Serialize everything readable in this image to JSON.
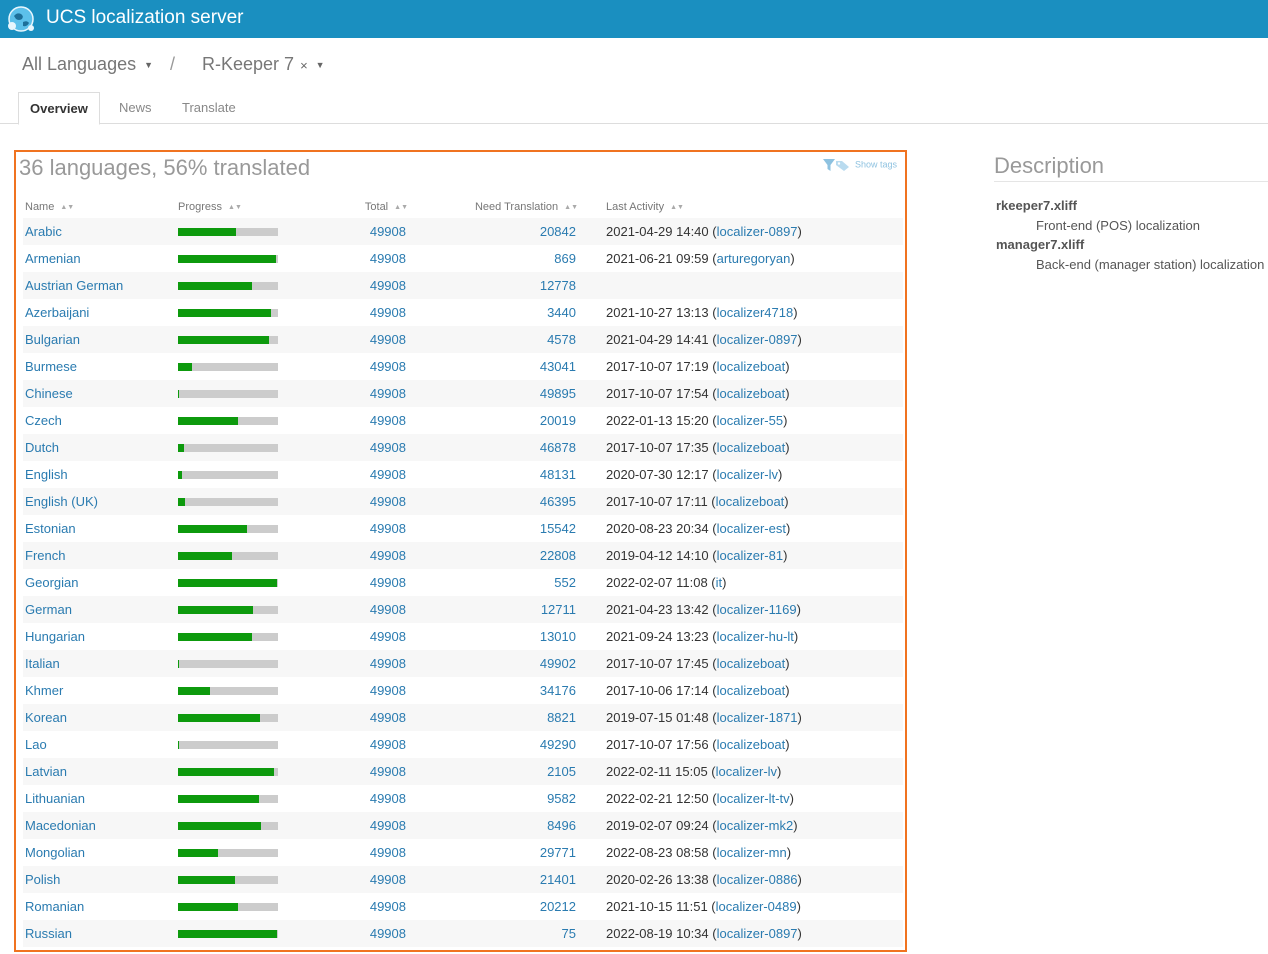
{
  "app": {
    "title": "UCS localization server"
  },
  "breadcrumb": {
    "languages": "All Languages",
    "separator": "/",
    "project": "R-Keeper 7",
    "remove": "×"
  },
  "tabs": [
    {
      "label": "Overview",
      "active": true
    },
    {
      "label": "News",
      "active": false
    },
    {
      "label": "Translate",
      "active": false
    }
  ],
  "summary": "36 languages, 56% translated",
  "show_tags": "Show tags",
  "columns": {
    "name": "Name",
    "progress": "Progress",
    "total": "Total",
    "need": "Need Translation",
    "activity": "Last Activity"
  },
  "rows": [
    {
      "name": "Arabic",
      "total": "49908",
      "need": "20842",
      "date": "2021-04-29 14:40",
      "user": "localizer-0897",
      "progress": 0.58
    },
    {
      "name": "Armenian",
      "total": "49908",
      "need": "869",
      "date": "2021-06-21 09:59",
      "user": "arturegoryan",
      "progress": 0.98
    },
    {
      "name": "Austrian German",
      "total": "49908",
      "need": "12778",
      "date": "",
      "user": "",
      "progress": 0.74
    },
    {
      "name": "Azerbaijani",
      "total": "49908",
      "need": "3440",
      "date": "2021-10-27 13:13",
      "user": "localizer4718",
      "progress": 0.93
    },
    {
      "name": "Bulgarian",
      "total": "49908",
      "need": "4578",
      "date": "2021-04-29 14:41",
      "user": "localizer-0897",
      "progress": 0.91
    },
    {
      "name": "Burmese",
      "total": "49908",
      "need": "43041",
      "date": "2017-10-07 17:19",
      "user": "localizeboat",
      "progress": 0.14
    },
    {
      "name": "Chinese",
      "total": "49908",
      "need": "49895",
      "date": "2017-10-07 17:54",
      "user": "localizeboat",
      "progress": 0.01
    },
    {
      "name": "Czech",
      "total": "49908",
      "need": "20019",
      "date": "2022-01-13 15:20",
      "user": "localizer-55",
      "progress": 0.6
    },
    {
      "name": "Dutch",
      "total": "49908",
      "need": "46878",
      "date": "2017-10-07 17:35",
      "user": "localizeboat",
      "progress": 0.06
    },
    {
      "name": "English",
      "total": "49908",
      "need": "48131",
      "date": "2020-07-30 12:17",
      "user": "localizer-lv",
      "progress": 0.04
    },
    {
      "name": "English (UK)",
      "total": "49908",
      "need": "46395",
      "date": "2017-10-07 17:11",
      "user": "localizeboat",
      "progress": 0.07
    },
    {
      "name": "Estonian",
      "total": "49908",
      "need": "15542",
      "date": "2020-08-23 20:34",
      "user": "localizer-est",
      "progress": 0.69
    },
    {
      "name": "French",
      "total": "49908",
      "need": "22808",
      "date": "2019-04-12 14:10",
      "user": "localizer-81",
      "progress": 0.54
    },
    {
      "name": "Georgian",
      "total": "49908",
      "need": "552",
      "date": "2022-02-07 11:08",
      "user": "it",
      "progress": 0.99
    },
    {
      "name": "German",
      "total": "49908",
      "need": "12711",
      "date": "2021-04-23 13:42",
      "user": "localizer-1169",
      "progress": 0.75
    },
    {
      "name": "Hungarian",
      "total": "49908",
      "need": "13010",
      "date": "2021-09-24 13:23",
      "user": "localizer-hu-lt",
      "progress": 0.74
    },
    {
      "name": "Italian",
      "total": "49908",
      "need": "49902",
      "date": "2017-10-07 17:45",
      "user": "localizeboat",
      "progress": 0.01
    },
    {
      "name": "Khmer",
      "total": "49908",
      "need": "34176",
      "date": "2017-10-06 17:14",
      "user": "localizeboat",
      "progress": 0.32
    },
    {
      "name": "Korean",
      "total": "49908",
      "need": "8821",
      "date": "2019-07-15 01:48",
      "user": "localizer-1871",
      "progress": 0.82
    },
    {
      "name": "Lao",
      "total": "49908",
      "need": "49290",
      "date": "2017-10-07 17:56",
      "user": "localizeboat",
      "progress": 0.01
    },
    {
      "name": "Latvian",
      "total": "49908",
      "need": "2105",
      "date": "2022-02-11 15:05",
      "user": "localizer-lv",
      "progress": 0.96
    },
    {
      "name": "Lithuanian",
      "total": "49908",
      "need": "9582",
      "date": "2022-02-21 12:50",
      "user": "localizer-lt-tv",
      "progress": 0.81
    },
    {
      "name": "Macedonian",
      "total": "49908",
      "need": "8496",
      "date": "2019-02-07 09:24",
      "user": "localizer-mk2",
      "progress": 0.83
    },
    {
      "name": "Mongolian",
      "total": "49908",
      "need": "29771",
      "date": "2022-08-23 08:58",
      "user": "localizer-mn",
      "progress": 0.4
    },
    {
      "name": "Polish",
      "total": "49908",
      "need": "21401",
      "date": "2020-02-26 13:38",
      "user": "localizer-0886",
      "progress": 0.57
    },
    {
      "name": "Romanian",
      "total": "49908",
      "need": "20212",
      "date": "2021-10-15 11:51",
      "user": "localizer-0489",
      "progress": 0.6
    },
    {
      "name": "Russian",
      "total": "49908",
      "need": "75",
      "date": "2022-08-19 10:34",
      "user": "localizer-0897",
      "progress": 0.99
    }
  ],
  "description": {
    "title": "Description",
    "files": [
      {
        "file": "rkeeper7.xliff",
        "text": "Front-end (POS) localization"
      },
      {
        "file": "manager7.xliff",
        "text": "Back-end (manager station) localization"
      }
    ]
  },
  "colors": {
    "header": "#1a8fc0",
    "link": "#2a7bb0",
    "progress_fill": "#0d9a0d",
    "progress_empty": "#cccccc",
    "highlight_border": "#f07320"
  }
}
